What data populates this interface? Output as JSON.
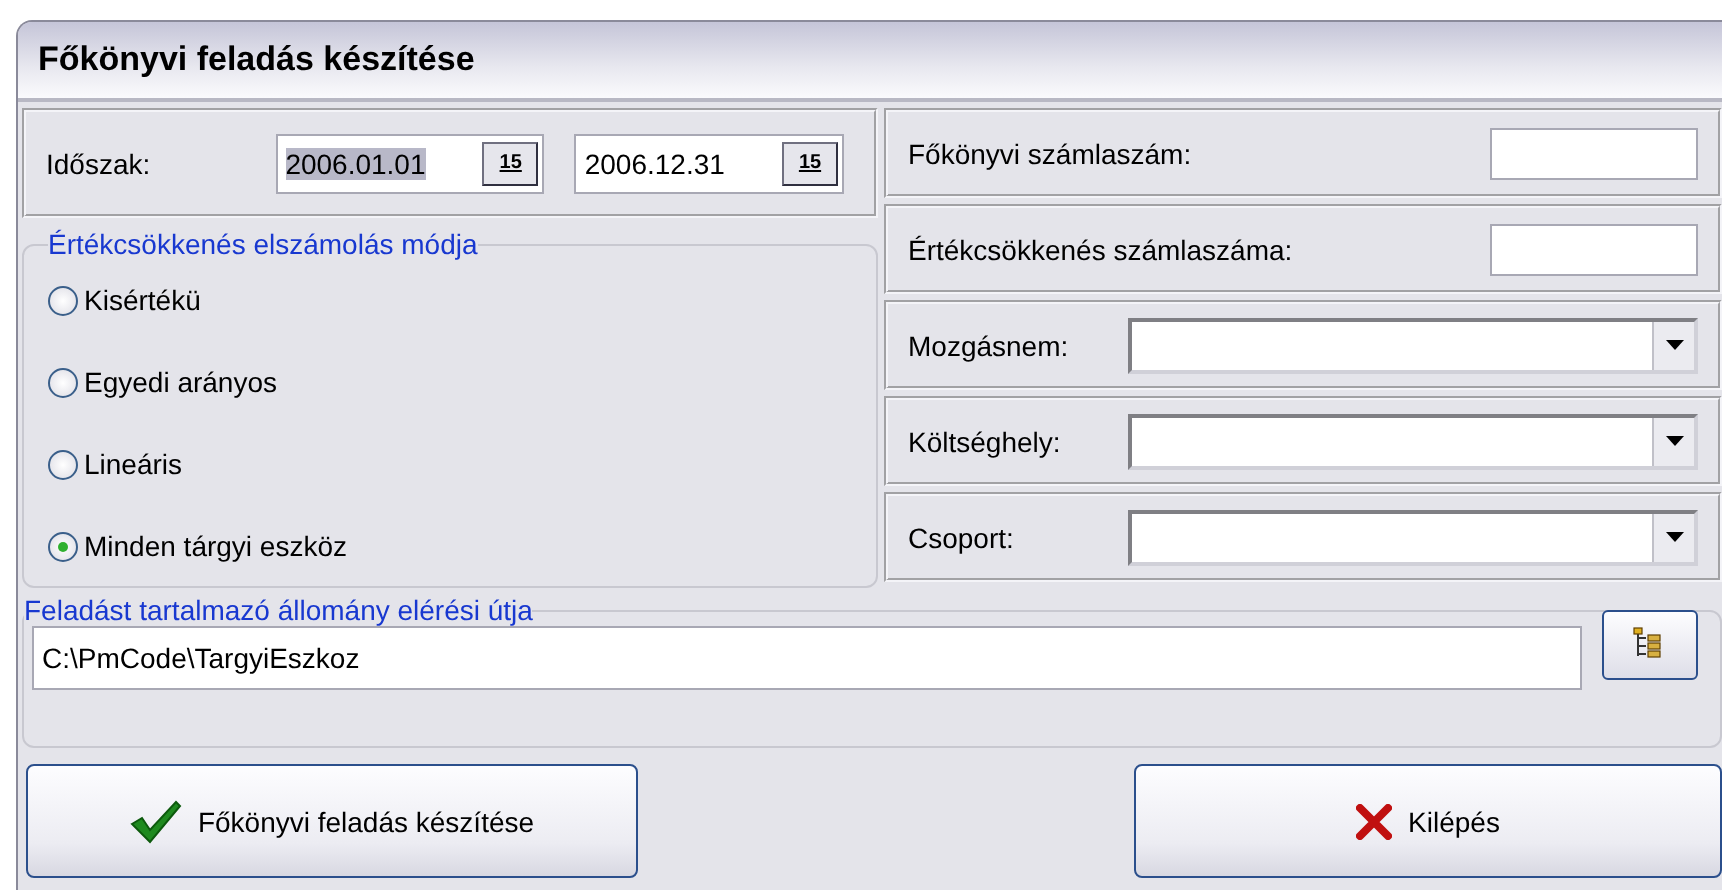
{
  "window": {
    "title": "Főkönyvi feladás készítése"
  },
  "period": {
    "label": "Időszak:",
    "from": {
      "value": "2006.01.01",
      "selected": true,
      "button": "15"
    },
    "to": {
      "value": "2006.12.31",
      "selected": false,
      "button": "15"
    }
  },
  "method_group": {
    "legend": "Értékcsökkenés elszámolás módja",
    "options": [
      {
        "label": "Kisértékü",
        "selected": false
      },
      {
        "label": "Egyedi arányos",
        "selected": false
      },
      {
        "label": "Lineáris",
        "selected": false
      },
      {
        "label": "Minden tárgyi eszköz",
        "selected": true
      }
    ]
  },
  "fields": [
    {
      "kind": "text",
      "label": "Főkönyvi számlaszám:"
    },
    {
      "kind": "text",
      "label": "Értékcsökkenés számlaszáma:"
    },
    {
      "kind": "combo",
      "label": "Mozgásnem:"
    },
    {
      "kind": "combo",
      "label": "Költséghely:"
    },
    {
      "kind": "combo",
      "label": "Csoport:"
    }
  ],
  "path_group": {
    "legend": "Feladást tartalmazó állomány elérési útja",
    "value": "C:\\PmCode\\TargyiEszkoz"
  },
  "buttons": [
    {
      "kind": "ok",
      "label": "Főkönyvi feladás készítése"
    },
    {
      "kind": "cancel",
      "label": "Kilépés"
    }
  ]
}
